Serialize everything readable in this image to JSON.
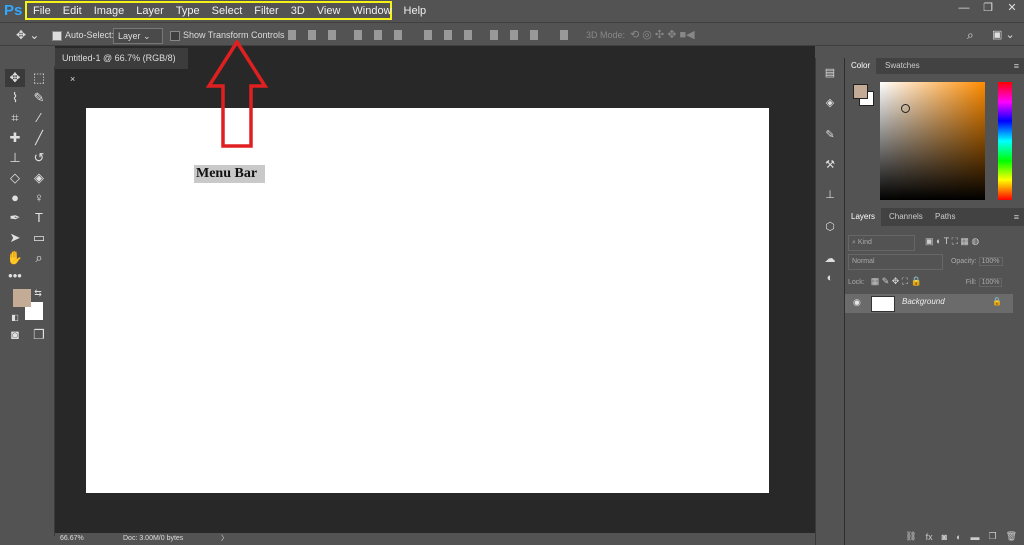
{
  "app": {
    "logo": "Ps"
  },
  "menu": [
    "File",
    "Edit",
    "Image",
    "Layer",
    "Type",
    "Select",
    "Filter",
    "3D",
    "View",
    "Window",
    "Help"
  ],
  "window_controls": [
    "—",
    "❐",
    "✕"
  ],
  "options": {
    "auto_select": "Auto-Select:",
    "target": "Layer",
    "show_transform": "Show Transform Controls",
    "mode_3d": "3D Mode:"
  },
  "document": {
    "tab_title": "Untitled-1 @ 66.7% (RGB/8)",
    "tab_close": "×",
    "annotation": "Menu Bar"
  },
  "status": {
    "zoom": "66.67%",
    "doc": "Doc: 3.00M/0 bytes",
    "arrow": "〉"
  },
  "color_panel": {
    "tabs": [
      "Color",
      "Swatches"
    ]
  },
  "layers_panel": {
    "tabs": [
      "Layers",
      "Channels",
      "Paths"
    ],
    "kind_label": "Kind",
    "blend_mode": "Normal",
    "opacity_label": "Opacity:",
    "opacity_value": "100%",
    "lock_label": "Lock:",
    "fill_label": "Fill:",
    "fill_value": "100%",
    "layer_name": "Background"
  },
  "colors": {
    "foreground": "#c3ab96",
    "background": "#ffffff",
    "highlight": "#f5f21a",
    "arrow": "#e02020"
  }
}
